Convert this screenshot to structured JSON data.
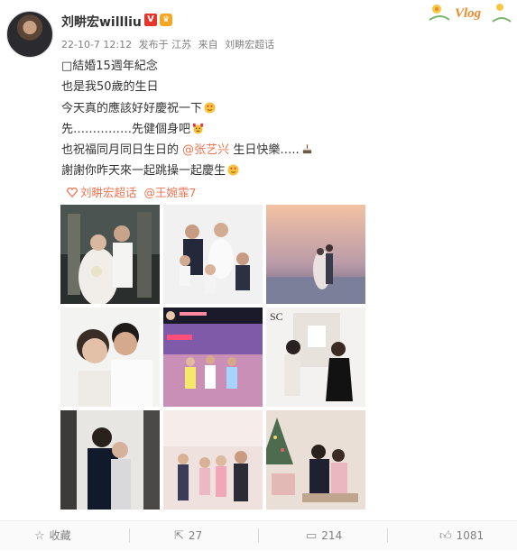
{
  "post": {
    "username": "刘畊宏willliu",
    "badge_v": "V",
    "meta": {
      "date": "22-10-7 12:12",
      "posted_from": "发布于 江苏",
      "source_prefix": "来自",
      "source_name": "刘畊宏超话"
    },
    "vlog_sticker": "Vlog",
    "lines": [
      "\u0000結婚15週年紀念",
      "也是我50歲的生日",
      "今天真的應該好好慶祝一下",
      "先……………先健個身吧",
      "",
      "謝謝你昨天來一起跳操一起慶生"
    ],
    "line1_display": "□結婚15週年紀念",
    "wish_line": {
      "prefix": "也祝福同月同日生日的",
      "mention": "@张艺兴",
      "suffix": "生日快樂….."
    },
    "tags": {
      "supertopic": "刘畊宏超话",
      "mention": "@王婉霏7"
    },
    "photos": [
      "wedding-photo",
      "family-white-photo",
      "sunset-couple-photo",
      "couple-closeup-photo",
      "livestream-dance-screenshot",
      "couple-studio-photo",
      "couple-embrace-photo",
      "family-pink-room-photo",
      "family-christmas-photo"
    ]
  },
  "footer": {
    "favorite_label": "收藏",
    "repost_count": "27",
    "comment_count": "214",
    "like_count": "1081"
  },
  "colors": {
    "mention": "#eb7350",
    "meta": "#808080",
    "text": "#333333"
  }
}
